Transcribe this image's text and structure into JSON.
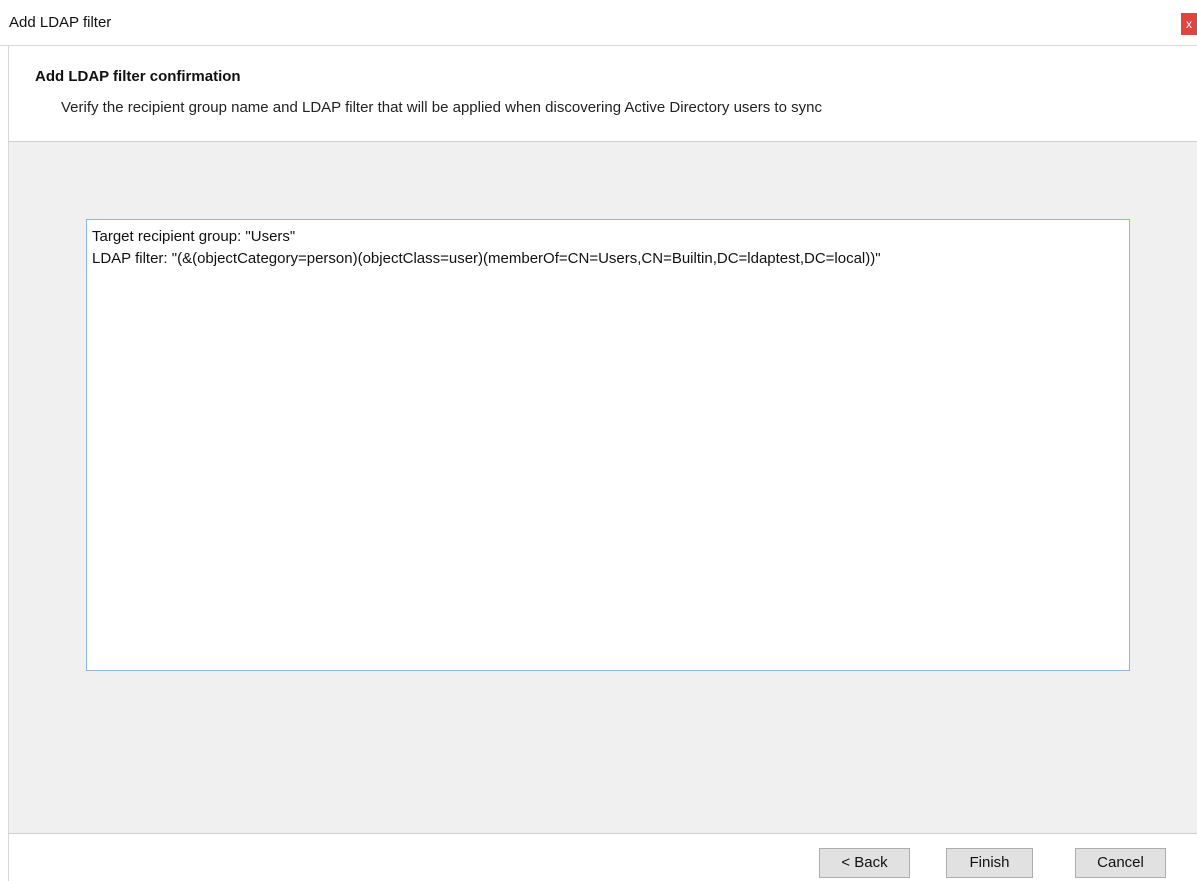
{
  "window": {
    "title": "Add LDAP filter",
    "close_glyph": "x"
  },
  "header": {
    "title": "Add LDAP filter confirmation",
    "subtitle": "Verify the recipient group name and LDAP filter that will be applied when discovering Active Directory users to sync"
  },
  "content": {
    "lines": [
      "Target recipient group: \"Users\"",
      "LDAP filter: \"(&(objectCategory=person)(objectClass=user)(memberOf=CN=Users,CN=Builtin,DC=ldaptest,DC=local))\""
    ]
  },
  "footer": {
    "back_label": "< Back",
    "finish_label": "Finish",
    "cancel_label": "Cancel"
  },
  "colors": {
    "close_button": "#e0443e",
    "content_background": "#f0f0f0",
    "textbox_border": "#8fb6e0"
  },
  "icons": {
    "close": "close-icon"
  }
}
